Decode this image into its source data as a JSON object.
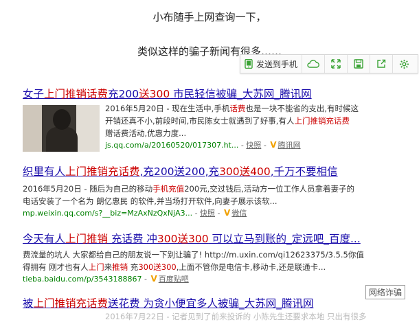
{
  "captions": {
    "line1": "小布随手上网查询一下，",
    "line2": "类似这样的骗子新闻有很多……"
  },
  "toolbar": {
    "send_label": "发送到手机",
    "icons": [
      "phone-icon",
      "cloud-icon",
      "expand-icon",
      "save-icon",
      "share-icon",
      "settings-icon"
    ],
    "accent": "#3aa335"
  },
  "results": [
    {
      "title_a": "女子",
      "title_hl1": "上门推销话费",
      "title_b": "充200",
      "title_hl2": "送300",
      "title_c": " 市民轻信被骗_大苏网_腾讯网",
      "snippet1_a": "2016年5月20日 - 现在生活中,手机",
      "snippet1_hl": "话费",
      "snippet1_b": "也是一块不能省的支出,有时候这",
      "snippet2_a": "开销还真不小,前段时间,市民陈女士就遇到了好事,有人",
      "snippet2_hl": "上门推销充话费",
      "snippet3": "赠话费活动,优惠力度...",
      "url": "js.qq.com/a/20160520/017307.ht...",
      "snapshot": "快照",
      "source": "腾讯网"
    },
    {
      "title_a": "织里有人",
      "title_hl1": "上门推销充话费",
      "title_b": ",充200送200,充",
      "title_hl2": "300送400",
      "title_c": ",千万不要相信",
      "snippet1_a": "2016年5月20日 - 随后为自己的移动",
      "snippet1_hl": "手机充值",
      "snippet1_b": "200元,交过钱后,活动方一位工作人员拿着妻子的",
      "snippet2": "电话安装了一个名为 朗亿惠民 的软件,并当场打开软件,向妻子展示该软...",
      "url": "mp.weixin.qq.com/s?__biz=MzAxNzQxNjA3...",
      "snapshot": "快照",
      "source": "微信"
    },
    {
      "title_a": "今天有人",
      "title_hl1": "上门推销",
      "title_b": " 充话费 冲",
      "title_hl2": "300送300",
      "title_c": " 可以立马到账的_定远吧_百度...",
      "snippet1": "费流量的坑人 大家都给自己的朋友说一下别让骗了! http://m.uxin.com/qi12623375/3.5.5你值",
      "snippet2_a": "得拥有 刚才也有人",
      "snippet2_hl1": "上门",
      "snippet2_b": "来",
      "snippet2_hl2": "推销",
      "snippet2_c": " 充",
      "snippet2_hl3": "300送300",
      "snippet2_d": ",上面不管你是电信卡,移动卡,还是联通卡...",
      "url": "tieba.baidu.com/p/3543188867",
      "source": "百度贴吧"
    },
    {
      "title_a": "被",
      "title_hl1": "上门推销充话费",
      "title_b": "送花费 为贪小便宜多人被骗_大苏网_腾讯网",
      "faded": "2016年7月22日 - 记者见到了前来投诉的 小陈先生还要求本地 只出有很多"
    }
  ],
  "watermark": "网络诈骗"
}
